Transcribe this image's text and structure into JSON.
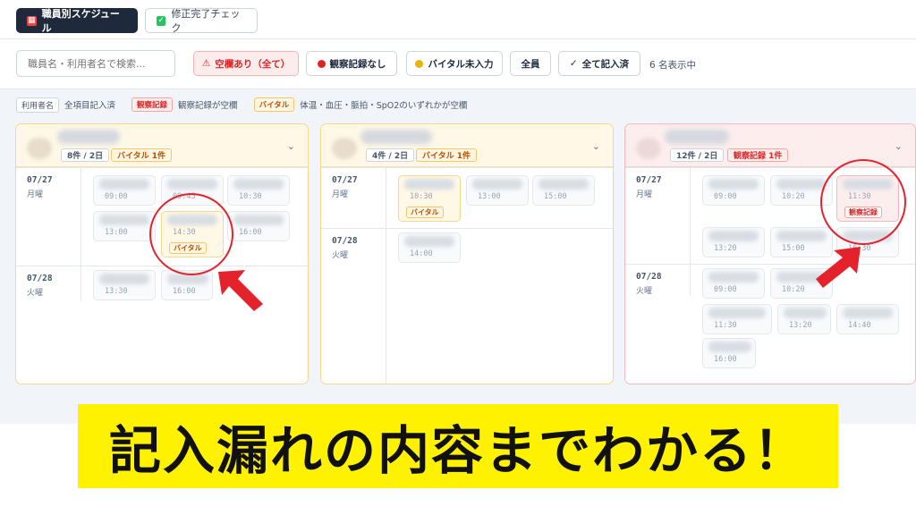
{
  "tabs": [
    {
      "label": "職員別スケジュール"
    },
    {
      "label": "修正完了チェック"
    }
  ],
  "search": {
    "placeholder": "職員名・利用者名で検索..."
  },
  "filters": {
    "empty_all": "空欄あり（全て）",
    "no_observation": "観察記録なし",
    "vital_missing": "バイタル未入力",
    "all_staff": "全員",
    "all_entered": "全て記入済",
    "display_count": "6 名表示中"
  },
  "legend": {
    "user_name": "利用者名",
    "all_entered": "全項目記入済",
    "obs_tag": "観察記録",
    "obs_desc": "観察記録が空欄",
    "vital_tag": "バイタル",
    "vital_desc": "体温・血圧・脈拍・SpO2のいずれかが空欄"
  },
  "cards": [
    {
      "summary": "8件 / 2日",
      "alert": "バイタル 1件",
      "days": [
        {
          "date": "07/27",
          "weekday": "月曜",
          "slots": [
            {
              "time": "09:00"
            },
            {
              "time": "09:45"
            },
            {
              "time": "10:30"
            },
            {
              "time": "13:00"
            },
            {
              "time": "14:30",
              "tag": "バイタル"
            },
            {
              "time": "16:00"
            }
          ]
        },
        {
          "date": "07/28",
          "weekday": "火曜",
          "slots": [
            {
              "time": "13:30"
            },
            {
              "time": "16:00"
            }
          ]
        }
      ]
    },
    {
      "summary": "4件 / 2日",
      "alert": "バイタル 1件",
      "days": [
        {
          "date": "07/27",
          "weekday": "月曜",
          "slots": [
            {
              "time": "10:30",
              "tag": "バイタル"
            },
            {
              "time": "13:00"
            },
            {
              "time": "15:00"
            }
          ]
        },
        {
          "date": "07/28",
          "weekday": "火曜",
          "slots": [
            {
              "time": "14:00"
            }
          ]
        }
      ]
    },
    {
      "summary": "12件 / 2日",
      "alert": "観察記録 1件",
      "days": [
        {
          "date": "07/27",
          "weekday": "月曜",
          "slots": [
            {
              "time": "09:00"
            },
            {
              "time": "10:20"
            },
            {
              "time": "11:30",
              "tag": "観察記録"
            },
            {
              "time": "13:20"
            },
            {
              "time": "15:00"
            },
            {
              "time": "16:30"
            }
          ]
        },
        {
          "date": "07/28",
          "weekday": "火曜",
          "slots": [
            {
              "time": "09:00"
            },
            {
              "time": "10:20"
            },
            {
              "time": "11:30"
            },
            {
              "time": "13:20"
            },
            {
              "time": "14:40"
            },
            {
              "time": "16:00"
            }
          ]
        }
      ]
    }
  ],
  "banner": {
    "text": "記入漏れの内容までわかる！"
  },
  "colors": {
    "highlight": "#e5222b",
    "banner_bg": "#fff200",
    "vital": "#b45309",
    "observation": "#dc2626"
  }
}
